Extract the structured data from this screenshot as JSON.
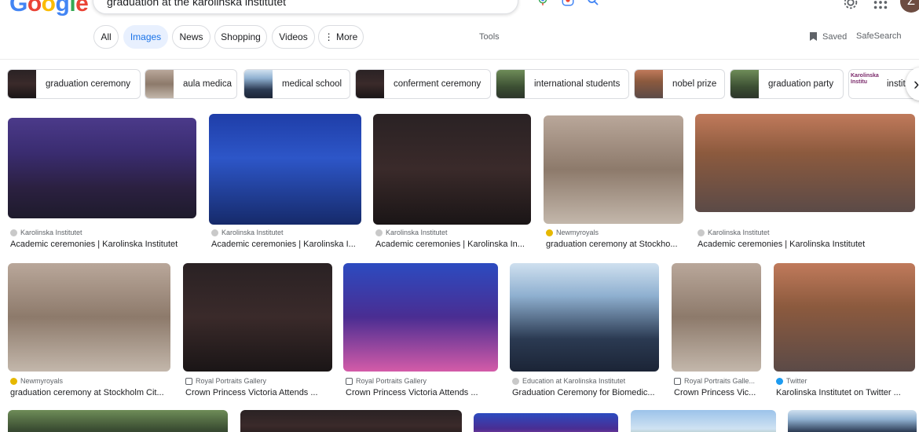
{
  "header": {
    "query": "graduation at the karolinska institutet",
    "avatar_letter": "Z"
  },
  "tabs": [
    {
      "label": "All"
    },
    {
      "label": "Images"
    },
    {
      "label": "News"
    },
    {
      "label": "Shopping"
    },
    {
      "label": "Videos"
    },
    {
      "label": "More"
    }
  ],
  "toolbar": {
    "tools": "Tools",
    "saved": "Saved",
    "safesearch": "SafeSearch"
  },
  "chips": [
    {
      "label": "graduation ceremony"
    },
    {
      "label": "aula medica"
    },
    {
      "label": "medical school"
    },
    {
      "label": "conferment ceremony"
    },
    {
      "label": "international students"
    },
    {
      "label": "nobel prize"
    },
    {
      "label": "graduation party"
    },
    {
      "label": "instit"
    }
  ],
  "chip_thumb_text": "Karolinska Institu",
  "results": [
    {
      "source": "Karolinska Institutet",
      "title": "Academic ceremonies | Karolinska Institutet"
    },
    {
      "source": "Karolinska Institutet",
      "title": "Academic ceremonies | Karolinska I..."
    },
    {
      "source": "Karolinska Institutet",
      "title": "Academic ceremonies | Karolinska In..."
    },
    {
      "source": "Newmyroyals",
      "title": "graduation ceremony at Stockho..."
    },
    {
      "source": "Karolinska Institutet",
      "title": "Academic ceremonies | Karolinska Institutet"
    },
    {
      "source": "Newmyroyals",
      "title": "graduation ceremony at Stockholm Cit..."
    },
    {
      "source": "Royal Portraits Gallery",
      "title": "Crown Princess Victoria Attends ..."
    },
    {
      "source": "Royal Portraits Gallery",
      "title": "Crown Princess Victoria Attends ..."
    },
    {
      "source": "Education at Karolinska Institutet",
      "title": "Graduation Ceremony for Biomedic..."
    },
    {
      "source": "Royal Portraits Galle...",
      "title": "Crown Princess Vic..."
    },
    {
      "source": "Twitter",
      "title": "Karolinska Institutet on Twitter ..."
    }
  ]
}
